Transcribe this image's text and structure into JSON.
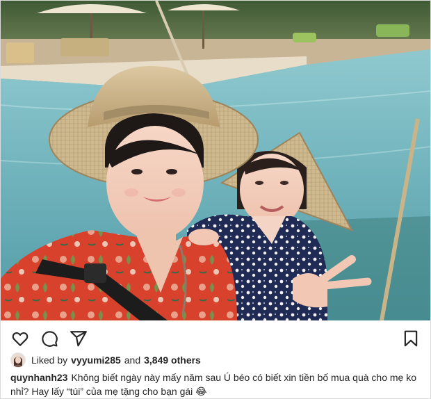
{
  "post": {
    "photo": {
      "subject": "selfie-photo"
    },
    "actions": {
      "like_icon": "heart-icon",
      "comment_icon": "comment-icon",
      "share_icon": "share-icon",
      "save_icon": "bookmark-icon"
    },
    "likes": {
      "prefix": "Liked by",
      "liker": "vyyumi285",
      "conjunction": "and",
      "others": "3,849 others"
    },
    "caption": {
      "username": "quynhanh23",
      "text": "Không biết ngày này mấy năm sau Ú béo có biết xin tiền bố mua quà cho mẹ ko nhỉ? Hay lấy “túi” của mẹ tặng cho bạn gái 😂"
    }
  },
  "colors": {
    "text": "#262626",
    "border": "#dbdbdb",
    "background": "#ffffff"
  }
}
